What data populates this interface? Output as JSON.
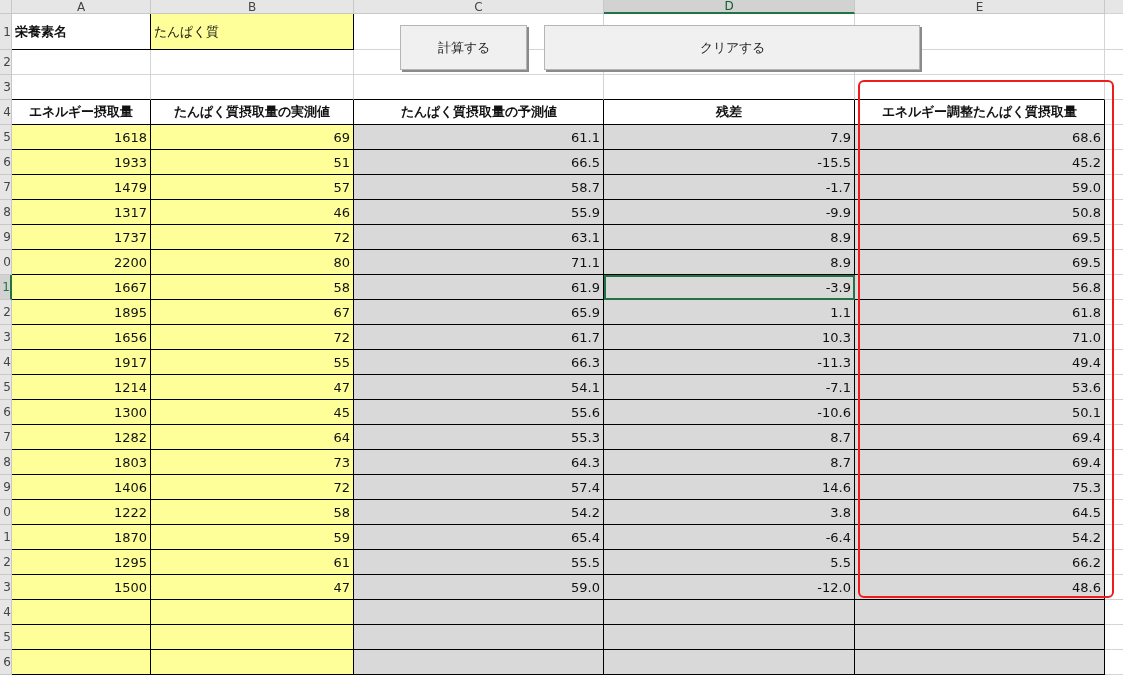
{
  "columns": [
    {
      "label": "A",
      "selected": false,
      "highlighted": false
    },
    {
      "label": "B",
      "selected": false,
      "highlighted": false
    },
    {
      "label": "C",
      "selected": false,
      "highlighted": false
    },
    {
      "label": "D",
      "selected": true,
      "highlighted": false
    },
    {
      "label": "E",
      "selected": false,
      "highlighted": true
    }
  ],
  "name_row": {
    "label": "1",
    "name_label": "栄養素名",
    "name_value": "たんぱく質"
  },
  "buttons": [
    "計算する",
    "クリアする"
  ],
  "blank_rows": [
    {
      "label": "2"
    },
    {
      "label": "3"
    }
  ],
  "header_row": {
    "label": "4",
    "headers": [
      "エネルギー摂取量",
      "たんぱく質摂取量の実測値",
      "たんぱく質摂取量の予測値",
      "残差",
      "エネルギー調整たんぱく質摂取量"
    ]
  },
  "rows": [
    {
      "label": "5",
      "selected": false,
      "values": [
        "1618",
        "69",
        "61.1",
        "7.9",
        "68.6"
      ]
    },
    {
      "label": "6",
      "selected": false,
      "values": [
        "1933",
        "51",
        "66.5",
        "-15.5",
        "45.2"
      ]
    },
    {
      "label": "7",
      "selected": false,
      "values": [
        "1479",
        "57",
        "58.7",
        "-1.7",
        "59.0"
      ]
    },
    {
      "label": "8",
      "selected": false,
      "values": [
        "1317",
        "46",
        "55.9",
        "-9.9",
        "50.8"
      ]
    },
    {
      "label": "9",
      "selected": false,
      "values": [
        "1737",
        "72",
        "63.1",
        "8.9",
        "69.5"
      ]
    },
    {
      "label": "0",
      "selected": false,
      "values": [
        "2200",
        "80",
        "71.1",
        "8.9",
        "69.5"
      ]
    },
    {
      "label": "1",
      "selected": true,
      "values": [
        "1667",
        "58",
        "61.9",
        "-3.9",
        "56.8"
      ]
    },
    {
      "label": "2",
      "selected": false,
      "values": [
        "1895",
        "67",
        "65.9",
        "1.1",
        "61.8"
      ]
    },
    {
      "label": "3",
      "selected": false,
      "values": [
        "1656",
        "72",
        "61.7",
        "10.3",
        "71.0"
      ]
    },
    {
      "label": "4",
      "selected": false,
      "values": [
        "1917",
        "55",
        "66.3",
        "-11.3",
        "49.4"
      ]
    },
    {
      "label": "5",
      "selected": false,
      "values": [
        "1214",
        "47",
        "54.1",
        "-7.1",
        "53.6"
      ]
    },
    {
      "label": "6",
      "selected": false,
      "values": [
        "1300",
        "45",
        "55.6",
        "-10.6",
        "50.1"
      ]
    },
    {
      "label": "7",
      "selected": false,
      "values": [
        "1282",
        "64",
        "55.3",
        "8.7",
        "69.4"
      ]
    },
    {
      "label": "8",
      "selected": false,
      "values": [
        "1803",
        "73",
        "64.3",
        "8.7",
        "69.4"
      ]
    },
    {
      "label": "9",
      "selected": false,
      "values": [
        "1406",
        "72",
        "57.4",
        "14.6",
        "75.3"
      ]
    },
    {
      "label": "0",
      "selected": false,
      "values": [
        "1222",
        "58",
        "54.2",
        "3.8",
        "64.5"
      ]
    },
    {
      "label": "1",
      "selected": false,
      "values": [
        "1870",
        "59",
        "65.4",
        "-6.4",
        "54.2"
      ]
    },
    {
      "label": "2",
      "selected": false,
      "values": [
        "1295",
        "61",
        "55.5",
        "5.5",
        "66.2"
      ]
    },
    {
      "label": "3",
      "selected": false,
      "values": [
        "1500",
        "47",
        "59.0",
        "-12.0",
        "48.6"
      ]
    }
  ],
  "empty_rows": [
    {
      "label": "4"
    },
    {
      "label": "5"
    },
    {
      "label": "6"
    }
  ]
}
